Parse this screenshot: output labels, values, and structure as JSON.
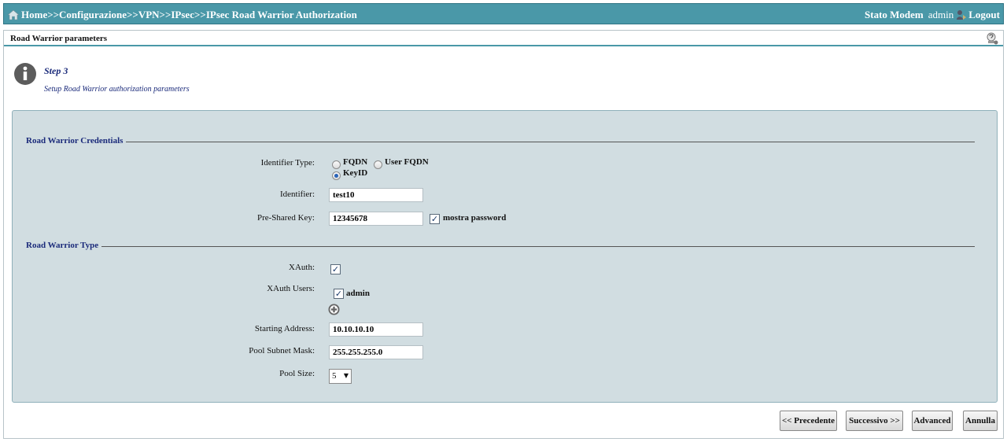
{
  "breadcrumb": {
    "home": "Home",
    "sep": ">>",
    "items": [
      "Configurazione",
      "VPN",
      "IPsec",
      "IPsec Road Warrior Authorization"
    ]
  },
  "header": {
    "status_link": "Stato Modem",
    "username": "admin",
    "logout": "Logout"
  },
  "panel": {
    "title": "Road Warrior parameters"
  },
  "step": {
    "title": "Step 3",
    "description": "Setup Road Warrior authorization parameters"
  },
  "credentials": {
    "legend": "Road Warrior Credentials",
    "identifier_type_label": "Identifier Type:",
    "options": [
      "FQDN",
      "User FQDN",
      "KeyID"
    ],
    "selected": "KeyID",
    "identifier_label": "Identifier:",
    "identifier_value": "test10",
    "psk_label": "Pre-Shared Key:",
    "psk_value": "12345678",
    "show_password_label": "mostra password",
    "show_password_checked": true
  },
  "type": {
    "legend": "Road Warrior Type",
    "xauth_label": "XAuth:",
    "xauth_checked": true,
    "xauth_users_label": "XAuth Users:",
    "xauth_users": [
      {
        "name": "admin",
        "checked": true
      }
    ],
    "starting_address_label": "Starting Address:",
    "starting_address_value": "10.10.10.10",
    "pool_mask_label": "Pool Subnet Mask:",
    "pool_mask_value": "255.255.255.0",
    "pool_size_label": "Pool Size:",
    "pool_size_value": "5"
  },
  "buttons": {
    "prev": "<< Precedente",
    "next": "Successivo >>",
    "advanced": "Advanced",
    "cancel": "Annulla"
  },
  "colors": {
    "topbar": "#4a98a8",
    "form_background": "#d1dde1",
    "legend_text": "#1a2a7a"
  }
}
